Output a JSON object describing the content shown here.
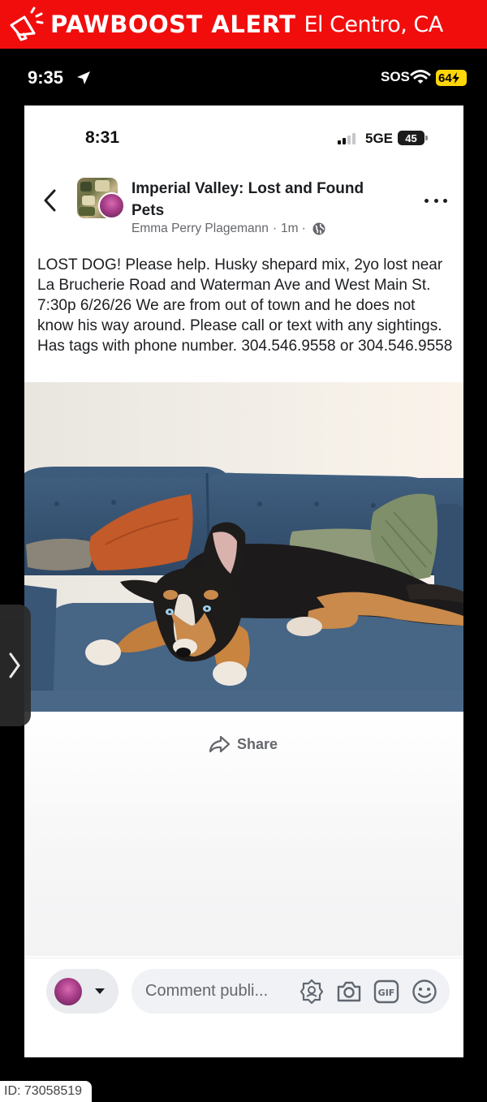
{
  "alert_banner": {
    "brand": "PAWBOOST ALERT",
    "location": "El Centro, CA",
    "icon": "megaphone-icon",
    "color": "#f20d0d"
  },
  "outer_status": {
    "time": "9:35",
    "sos": "SOS",
    "battery": "64"
  },
  "inner_status": {
    "time": "8:31",
    "network": "5GE",
    "battery": "45"
  },
  "post": {
    "group_name": "Imperial Valley: Lost and Found Pets",
    "author": "Emma Perry Plagemann",
    "time_ago": "1m",
    "separator": "·",
    "text": "LOST DOG! Please help. Husky shepard mix, 2yo lost near La Brucherie Road and Waterman Ave and West Main St. 7:30p 6/26/26 We are from out of town and he does not know his way around.  Please call or text with any sightings. Has tags with phone number. 304.546.9558 or 304.546.9558",
    "photo_alt": "husky-shepherd-dog-on-blue-couch",
    "share_label": "Share"
  },
  "composer": {
    "placeholder": "Comment publi..."
  },
  "footer": {
    "id_label": "ID: 73058519"
  }
}
